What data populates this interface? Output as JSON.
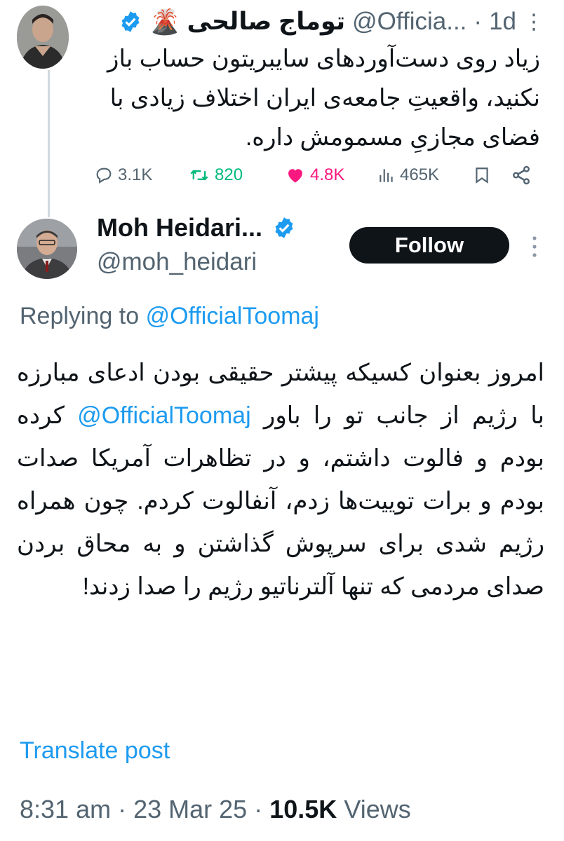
{
  "colors": {
    "accent": "#1d9bf0",
    "secondary_text": "#536471",
    "like": "#f91880",
    "retweet": "#00ba7c"
  },
  "parent_tweet": {
    "author_name": "توماج صالحی",
    "author_emoji": "🌋",
    "handle": "@Officia...",
    "separator": "·",
    "time": "1d",
    "text": "زیاد روی دست‌آوردهای سایبریتون حساب باز نکنید، واقعیتِ جامعه‌ی ایران اختلاف زیادی با فضای مجازیِ مسمومش داره.",
    "actions": {
      "replies": "3.1K",
      "retweets": "820",
      "likes": "4.8K",
      "views": "465K"
    },
    "icons": [
      "reply-icon",
      "retweet-icon",
      "heart-icon",
      "views-icon",
      "bookmark-icon",
      "share-icon"
    ]
  },
  "reply_tweet": {
    "author_name": "Moh Heidari...",
    "handle": "@moh_heidari",
    "follow_label": "Follow",
    "replying_prefix": "Replying to",
    "replying_to": "@OfficialToomaj",
    "text_part1": "امروز بعنوان کسیکه پیشتر حقیقی بودن ادعای مبارزه با رژیم از جانب تو را باور",
    "mention": "@OfficialToomaj",
    "text_part2": "کرده بودم و فالوت داشتم، و در تظاهرات آمریکا صدات بودم و برات توییت‌ها زدم، آنفالوت کردم. چون همراه رژیم شدی برای سرپوش گذاشتن و به محاق بردن صدای مردمی که تنها آلترناتیو رژیم را صدا زدند!",
    "translate_label": "Translate post",
    "time": "8:31 am",
    "separator": "·",
    "date": "23 Mar 25",
    "views_count": "10.5K",
    "views_label": "Views"
  }
}
